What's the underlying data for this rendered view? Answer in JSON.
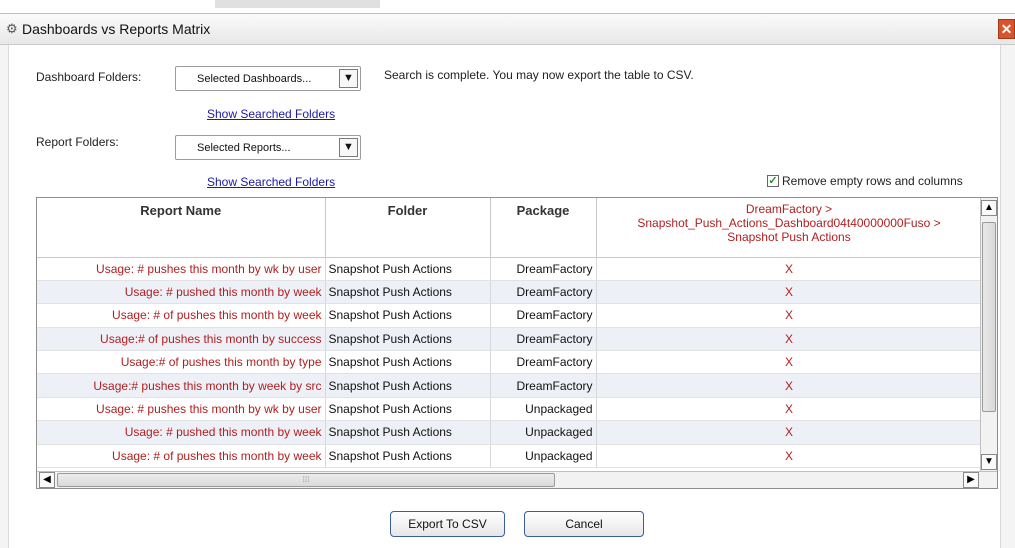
{
  "window": {
    "title": "Dashboards vs Reports Matrix"
  },
  "dashboard_folders": {
    "label": "Dashboard Folders:",
    "selected": "Selected Dashboards...",
    "link": "Show Searched Folders"
  },
  "report_folders": {
    "label": "Report Folders:",
    "selected": "Selected Reports...",
    "link": "Show Searched Folders"
  },
  "status": "Search is complete. You may now export the table to CSV.",
  "remove_empty": {
    "label": "Remove empty rows and columns",
    "checked": true
  },
  "table": {
    "headers": {
      "report_name": "Report Name",
      "folder": "Folder",
      "package": "Package",
      "dashboard_line1": "DreamFactory >",
      "dashboard_line2": "Snapshot_Push_Actions_Dashboard04t40000000Fuso >",
      "dashboard_line3": "Snapshot Push Actions"
    },
    "rows": [
      {
        "name": "Usage: # pushes this month by wk by user",
        "folder": "Snapshot Push Actions",
        "package": "DreamFactory",
        "mark": "X"
      },
      {
        "name": "Usage: # pushed this month by week",
        "folder": "Snapshot Push Actions",
        "package": "DreamFactory",
        "mark": "X"
      },
      {
        "name": "Usage: # of pushes this month by week",
        "folder": "Snapshot Push Actions",
        "package": "DreamFactory",
        "mark": "X"
      },
      {
        "name": "Usage:# of pushes this month by success",
        "folder": "Snapshot Push Actions",
        "package": "DreamFactory",
        "mark": "X"
      },
      {
        "name": "Usage:# of pushes this month by type",
        "folder": "Snapshot Push Actions",
        "package": "DreamFactory",
        "mark": "X"
      },
      {
        "name": "Usage:# pushes this month by week by src",
        "folder": "Snapshot Push Actions",
        "package": "DreamFactory",
        "mark": "X"
      },
      {
        "name": "Usage: # pushes this month by wk by user",
        "folder": "Snapshot Push Actions",
        "package": "Unpackaged",
        "mark": "X"
      },
      {
        "name": "Usage: # pushed this month by week",
        "folder": "Snapshot Push Actions",
        "package": "Unpackaged",
        "mark": "X"
      },
      {
        "name": "Usage: # of pushes this month by week",
        "folder": "Snapshot Push Actions",
        "package": "Unpackaged",
        "mark": "X"
      }
    ]
  },
  "buttons": {
    "export": "Export To CSV",
    "cancel": "Cancel"
  },
  "colors": {
    "report_text": "#b02020",
    "alt_row": "#eef0f7",
    "link": "#1a1aa6"
  }
}
